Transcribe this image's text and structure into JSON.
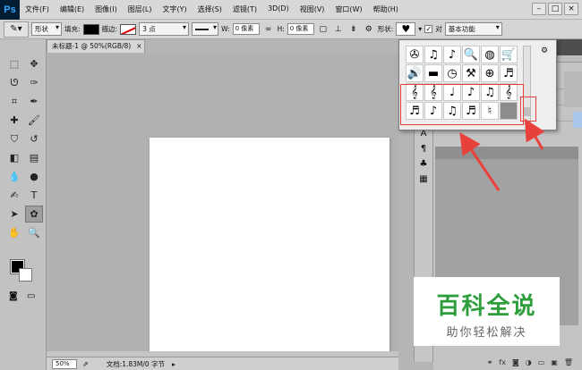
{
  "app": {
    "logo": "Ps",
    "menu": [
      "文件(F)",
      "编辑(E)",
      "图像(I)",
      "图层(L)",
      "文字(Y)",
      "选择(S)",
      "滤镜(T)",
      "3D(D)",
      "视图(V)",
      "窗口(W)",
      "帮助(H)"
    ],
    "window_controls": [
      "–",
      "□",
      "×"
    ]
  },
  "options": {
    "mode": "形状",
    "fill_label": "填充:",
    "stroke_label": "描边:",
    "stroke_width": "3 点",
    "w_label": "W:",
    "w_value": "0 像素",
    "link_icon": "∞",
    "h_label": "H:",
    "h_value": "0 像素",
    "shape_label": "形状:",
    "shape_glyph": "♥",
    "align_label": "对",
    "workspace": "基本功能"
  },
  "document": {
    "tab_title": "未标题-1 @ 50%(RGB/8)",
    "tab_close": "×"
  },
  "status": {
    "zoom": "50%",
    "info": "文档:1.83M/0 字节",
    "arrow": "▸"
  },
  "popup": {
    "gear": "⚙",
    "shapes": [
      {
        "name": "film-reel",
        "glyph": "✇"
      },
      {
        "name": "music-disc",
        "glyph": "♫"
      },
      {
        "name": "music-note-circle",
        "glyph": "♪"
      },
      {
        "name": "magnifier",
        "glyph": "🔍"
      },
      {
        "name": "globe-cursor",
        "glyph": "◍"
      },
      {
        "name": "shopping-cart",
        "glyph": "🛒"
      },
      {
        "name": "speaker",
        "glyph": "🔊"
      },
      {
        "name": "bar",
        "glyph": "▬"
      },
      {
        "name": "clock",
        "glyph": "◷"
      },
      {
        "name": "tools",
        "glyph": "⚒"
      },
      {
        "name": "world-globe",
        "glyph": "⊕"
      },
      {
        "name": "music-score",
        "glyph": "♬"
      },
      {
        "name": "treble-clef-staff",
        "glyph": "𝄞"
      },
      {
        "name": "treble-clef",
        "glyph": "𝄞"
      },
      {
        "name": "quarter-note",
        "glyph": "♩"
      },
      {
        "name": "eighth-note",
        "glyph": "♪"
      },
      {
        "name": "music-staff",
        "glyph": "♫"
      },
      {
        "name": "treble-clef-circle",
        "glyph": "𝄞"
      },
      {
        "name": "staff-note",
        "glyph": "♬"
      },
      {
        "name": "note-single",
        "glyph": "♪"
      },
      {
        "name": "beamed-notes",
        "glyph": "♫"
      },
      {
        "name": "sixteenth-notes",
        "glyph": "♬"
      },
      {
        "name": "natural-sign",
        "glyph": "♮"
      },
      {
        "name": "empty",
        "glyph": ""
      }
    ]
  },
  "panel_strip_icons": [
    "A",
    "¶",
    "♣",
    "▦"
  ],
  "panel_footer_icons": [
    "⚭",
    "fx",
    "◙",
    "◑",
    "▭",
    "▣",
    "🗑"
  ],
  "watermark": {
    "title": "百科全说",
    "subtitle": "助你轻松解决"
  },
  "colors": {
    "accent_red": "#e8413c",
    "watermark_green": "#2e9e3c"
  }
}
